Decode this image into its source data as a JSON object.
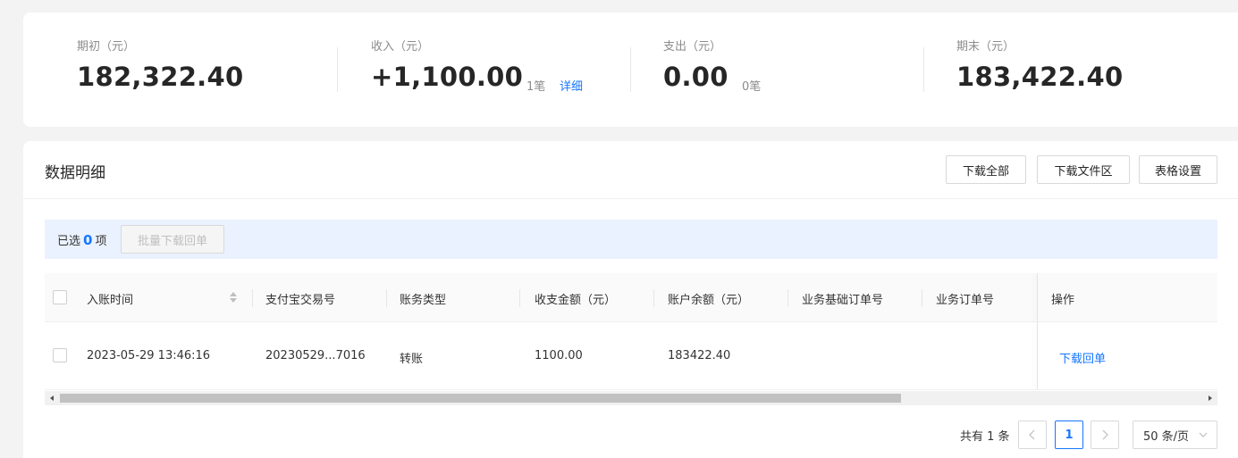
{
  "summary": {
    "opening": {
      "label": "期初（元）",
      "amount": "182,322.40"
    },
    "income": {
      "label": "收入（元）",
      "amount": "+1,100.00",
      "count": "1笔",
      "link": "详细"
    },
    "expense": {
      "label": "支出（元）",
      "amount": "0.00",
      "count": "0笔"
    },
    "closing": {
      "label": "期末（元）",
      "amount": "183,422.40"
    }
  },
  "detail": {
    "title": "数据明细",
    "buttons": {
      "download_all": "下载全部",
      "download_area": "下载文件区",
      "table_settings": "表格设置"
    }
  },
  "selection": {
    "prefix": "已选",
    "count": "0",
    "suffix": "项",
    "bulk_button": "批量下载回单"
  },
  "table": {
    "columns": [
      "入账时间",
      "支付宝交易号",
      "账务类型",
      "收支金额（元）",
      "账户余额（元）",
      "业务基础订单号",
      "业务订单号",
      "操作"
    ],
    "rows": [
      {
        "time": "2023-05-29 13:46:16",
        "trade_no": "20230529...7016",
        "type": "转账",
        "amount": "1100.00",
        "balance": "183422.40",
        "base_order": "",
        "order": "",
        "action": "下载回单"
      }
    ]
  },
  "pagination": {
    "total": "共有 1 条",
    "current_page": "1",
    "page_size": "50 条/页"
  },
  "colors": {
    "accent": "#1677ff",
    "selection_bg": "#eaf2ff"
  }
}
